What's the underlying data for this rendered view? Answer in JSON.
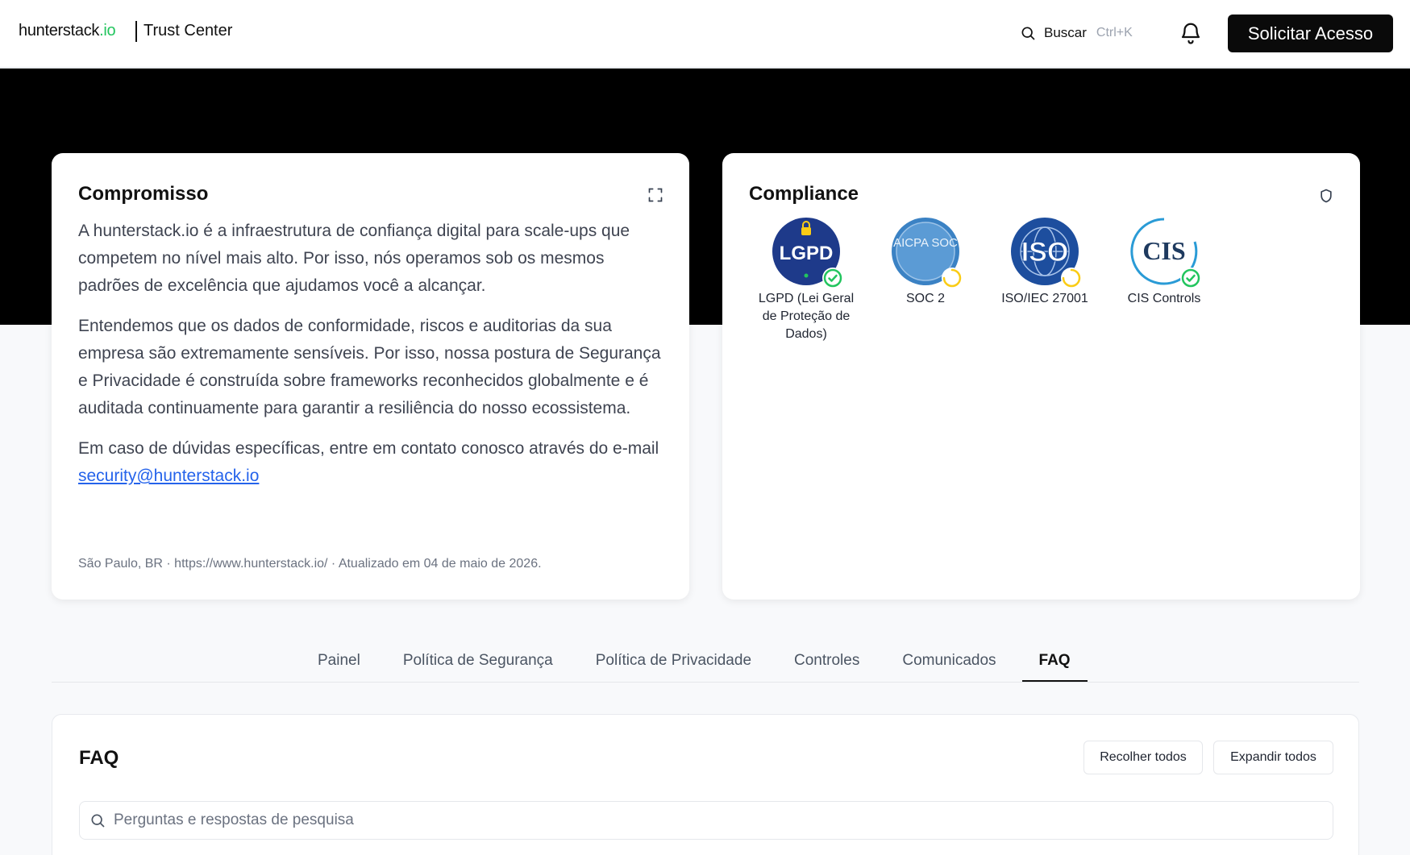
{
  "header": {
    "brand_name": "hunterstack",
    "brand_tld": ".io",
    "subtitle": "Trust Center",
    "search_label": "Buscar",
    "search_shortcut": "Ctrl+K",
    "cta_label": "Solicitar Acesso"
  },
  "commitment": {
    "title": "Compromisso",
    "paragraph1": "A hunterstack.io é a infraestrutura de confiança digital para scale-ups que competem no nível mais alto. Por isso, nós operamos sob os mesmos padrões de excelência que ajudamos você a alcançar.",
    "paragraph2": "Entendemos que os dados de conformidade, riscos e auditorias da sua empresa são extremamente sensíveis. Por isso, nossa postura de Segurança e Privacidade é construída sobre frameworks reconhecidos globalmente e é auditada continuamente para garantir a resiliência do nosso ecossistema.",
    "paragraph3_prefix": "Em caso de dúvidas específicas, entre em contato conosco através do e-mail ",
    "email": "security@hunterstack.io",
    "meta": "São Paulo, BR · https://www.hunterstack.io/ · Atualizado em 04 de maio de 2026."
  },
  "compliance": {
    "title": "Compliance",
    "badges": [
      {
        "label": "LGPD (Lei Geral de Proteção de Dados)",
        "status": "compliant",
        "logo_text": "LGPD",
        "icon": "lgpd-logo-icon"
      },
      {
        "label": "SOC 2",
        "status": "in-progress",
        "logo_text": "AICPA SOC",
        "icon": "soc2-logo-icon"
      },
      {
        "label": "ISO/IEC 27001",
        "status": "in-progress",
        "logo_text": "ISO",
        "icon": "iso-logo-icon"
      },
      {
        "label": "CIS Controls",
        "status": "compliant",
        "logo_text": "CIS",
        "icon": "cis-logo-icon"
      }
    ]
  },
  "tabs": [
    {
      "label": "Painel",
      "active": false
    },
    {
      "label": "Política de Segurança",
      "active": false
    },
    {
      "label": "Política de Privacidade",
      "active": false
    },
    {
      "label": "Controles",
      "active": false
    },
    {
      "label": "Comunicados",
      "active": false
    },
    {
      "label": "FAQ",
      "active": true
    }
  ],
  "faq": {
    "title": "FAQ",
    "collapse_all": "Recolher todos",
    "expand_all": "Expandir todos",
    "search_placeholder": "Perguntas e respostas de pesquisa"
  },
  "colors": {
    "brand_accent": "#22c55e",
    "status_compliant": "#22c55e",
    "status_in_progress": "#facc15",
    "link": "#2563eb",
    "hero_background": "#000000"
  }
}
